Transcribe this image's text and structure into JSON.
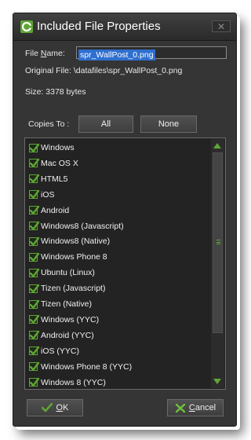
{
  "window": {
    "title": "Included File Properties",
    "close_label": "✕"
  },
  "file": {
    "name_label_underlined": "N",
    "name_label_rest": "ame:",
    "name_label_prefix": "File ",
    "name_value": "spr_WallPost_0.png",
    "original_label": "Original File: \\datafiles\\spr_WallPost_0.png",
    "size_label": "Size: 3378 bytes"
  },
  "copies": {
    "label": "Copies To :",
    "all_label": "All",
    "none_label": "None"
  },
  "targets": [
    {
      "label": "Windows",
      "checked": true
    },
    {
      "label": "Mac OS X",
      "checked": true
    },
    {
      "label": "HTML5",
      "checked": true
    },
    {
      "label": "iOS",
      "checked": true
    },
    {
      "label": "Android",
      "checked": true
    },
    {
      "label": "Windows8 (Javascript)",
      "checked": true
    },
    {
      "label": "Windows8 (Native)",
      "checked": true
    },
    {
      "label": "Windows Phone 8",
      "checked": true
    },
    {
      "label": "Ubuntu (Linux)",
      "checked": true
    },
    {
      "label": "Tizen (Javascript)",
      "checked": true
    },
    {
      "label": "Tizen (Native)",
      "checked": true
    },
    {
      "label": "Windows (YYC)",
      "checked": true
    },
    {
      "label": "Android (YYC)",
      "checked": true
    },
    {
      "label": "iOS (YYC)",
      "checked": true
    },
    {
      "label": "Windows Phone 8 (YYC)",
      "checked": true
    },
    {
      "label": "Windows 8 (YYC)",
      "checked": true
    }
  ],
  "buttons": {
    "ok_underlined": "O",
    "ok_rest": "K",
    "cancel_underlined": "C",
    "cancel_rest": "ancel"
  },
  "colors": {
    "accent_green": "#5fa534",
    "cancel_x_green": "#6fc33a",
    "selection_blue": "#2f6fcf"
  }
}
